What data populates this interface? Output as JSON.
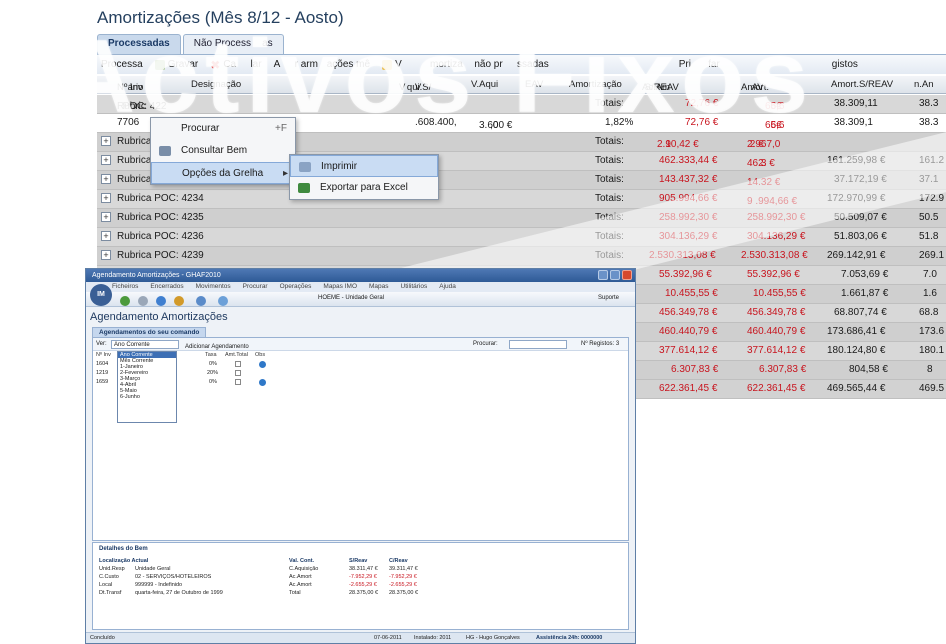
{
  "back": {
    "title": "Amortizações (Mês 8/12 - A",
    "title_tail": "osto)",
    "tabs": [
      {
        "label": "Processadas"
      },
      {
        "label": "Não Process",
        "tail": "as"
      }
    ],
    "toolbar": {
      "process": "Processa",
      "save": "Gravar",
      "cancel": "Ca",
      "cancel_tail": "lar",
      "warn_a": "A",
      "warn_a_tail": "r arm",
      "warn_a_end": "ações mê",
      "v_label": "V",
      "amort_label": "mortiza",
      "not_processed": "não pr",
      "not_processed_end": "ssadas",
      "pr": "Pri",
      "pr_tail": "far",
      "regist": "gistos"
    },
    "columns": {
      "inv": "Nº Inv",
      "inv_tail": "ário",
      "desig": "Designação",
      "vaqui": "V",
      "vaqui_tail": "qui.S/",
      "vaqui_end": "V",
      "vaqui2": "V.Aqui",
      "reav": "EAV",
      "amort": "Amortização",
      "acam": "Ac.Am",
      "acam_tail": "S/REAV",
      "amort2": "Amort.",
      "amort2_tail": "AV",
      "amort_s": "Amort.S/REAV",
      "an": "n.An"
    },
    "rows": [
      {
        "label": "Rubric",
        "label_tail": "POC: 422",
        "totals": "Totais:",
        "acam": "72,76 €",
        "amort2": "65,6",
        "amort2_tail": "6€",
        "amort_s": "38.309,11",
        "last": "38.3"
      },
      {
        "label": "7706",
        "v1": ".608.400,",
        "v2": "3.60",
        "v2_tail": ",00 €",
        "pct": "1,82%",
        "acam": "72,76 €",
        "amort2": "65,6",
        "amort2_tail": "6€",
        "amort_s": "38.309,1",
        "last": "38.3"
      },
      {
        "label": "Rubrica",
        "totals": "Totais:",
        "acam": "2.9",
        "acam_tail": "10,42 €",
        "amort2": "2.967,0",
        "amort2_tail": "2 €",
        "amort_s": "",
        "last": ""
      },
      {
        "label": "Rubrica",
        "totals": "Totais:",
        "acam": "462.333,44 €",
        "amort2": "462.",
        "amort2_tail": "3 €",
        "amort_s": "161.259,98 €",
        "last": "161.2"
      },
      {
        "label": "Rubrica",
        "totals": "Totais:",
        "acam": "143.437,32 €",
        "amort2": "14",
        "amort2_tail": ".32 €",
        "amort_s": "37.172,19 €",
        "last": "37.1"
      },
      {
        "label": "Rubrica POC: 4234",
        "totals": "Totais:",
        "acam": "905.994,66 €",
        "amort2": "9",
        "amort2_tail": ".994,66 €",
        "amort_s": "172.970,99 €",
        "last": "172.9"
      },
      {
        "label": "Rubrica POC: 4235",
        "totals": "Totais:",
        "acam": "258.992,30 €",
        "amort2": "258.992,30 €",
        "amort_s": "50.509,07 €",
        "last": "50.5"
      },
      {
        "label": "Rubrica POC: 4236",
        "totals": "Totais:",
        "acam": "304.136,29 €",
        "amort2": "304.136,29 €",
        "amort_s": "51.803,06 €",
        "last": "51.8"
      },
      {
        "label": "Rubrica POC: 4239",
        "totals": "Totais:",
        "acam": "2.530.313,08 €",
        "amort2": "2.530.313,08 €",
        "amort_s": "269.142,91 €",
        "last": "269.1"
      },
      {
        "label": "",
        "acam": "55.392,96 €",
        "amort2": "55.392,96 €",
        "amort_s": "7.053,69 €",
        "last": "7.0"
      },
      {
        "label": "",
        "acam": "10.455,55 €",
        "amort2": "10.455,55 €",
        "amort_s": "1.661,87 €",
        "last": "1.6"
      },
      {
        "label": "",
        "acam": "456.349,78 €",
        "amort2": "456.349,78 €",
        "amort_s": "68.807,74 €",
        "last": "68.8"
      },
      {
        "label": "",
        "acam": "460.440,79 €",
        "amort2": "460.440,79 €",
        "amort_s": "173.686,41 €",
        "last": "173.6"
      },
      {
        "label": "",
        "acam": "377.614,12 €",
        "amort2": "377.614,12 €",
        "amort_s": "180.124,80 €",
        "last": "180.1"
      },
      {
        "label": "",
        "acam": "6.307,83 €",
        "amort2": "6.307,83 €",
        "amort_s": "804,58 €",
        "last": "8"
      },
      {
        "label": "",
        "acam": "622.361,45 €",
        "amort2": "622.361,45 €",
        "amort_s": "469.565,44 €",
        "last": "469.5"
      }
    ]
  },
  "watermark": "Activos Fixos",
  "context_menu": {
    "items": [
      {
        "label": "Procurar",
        "key": "+F"
      },
      {
        "label": "Consultar Bem"
      },
      {
        "label": "Opções da Grelha"
      }
    ]
  },
  "submenu": {
    "items": [
      {
        "label": "Imprimir"
      },
      {
        "label": "Exportar para Excel"
      }
    ]
  },
  "front": {
    "window_title": "Agendamento Amortizações - GHAF2010",
    "menu": [
      "Ficheiros",
      "Encerrados",
      "Movimentos",
      "Procurar",
      "Operações",
      "Mapas IMO",
      "Mapas",
      "Utilitários",
      "Ajuda"
    ],
    "logo": "IM",
    "toolbar_entity": "HOEME - Unidade Geral",
    "toolbar_support": "Suporte",
    "heading": "Agendamento Amortizações",
    "tab": "Agendamentos do seu comando",
    "filter": {
      "ver_label": "Ver:",
      "ver_value": "Ano Corrente",
      "add_label": "Adicionar Agendamento",
      "search_label": "Procurar:",
      "records_label": "Nº Registos: 3"
    },
    "dropdown_options": [
      "Ano Corrente",
      "Mês Corrente",
      "1-Janeiro",
      "2-Fevereiro",
      "3-Março",
      "4-Abril",
      "5-Maio",
      "6-Junho"
    ],
    "grid_cols": [
      "Nº Inv",
      "Taxa",
      "Amt.Total",
      "Obs"
    ],
    "grid_rows": [
      {
        "inv": "1604",
        "rate": "0%"
      },
      {
        "inv": "1219",
        "rate": "20%"
      },
      {
        "inv": "1659",
        "rate": "0%"
      }
    ],
    "details": {
      "title": "Detalhes do Bem",
      "loc_header": "Localização Actual",
      "loc": [
        {
          "k": "Unid.Resp",
          "v": "Unidade Geral"
        },
        {
          "k": "C.Custo",
          "v": "02 - SERVIÇOS/HOTELEIROS"
        },
        {
          "k": "Local",
          "v": "999999 - Indefinido"
        },
        {
          "k": "Dt.Transf",
          "v": "quarta-feira, 27 de Outubro de 1999"
        }
      ],
      "val_header": "Val. Cont.",
      "val_cols": [
        "S/Reav",
        "C/Reav"
      ],
      "val_rows": [
        {
          "k": "C.Aquisição",
          "a": "38.311,47 €",
          "b": "39.311,47 €"
        },
        {
          "k": "Ac.Amort",
          "a": "-7.952,29 €",
          "b": "-7.952,29 €"
        },
        {
          "k": "Ac.Amort",
          "a": "-2.655,29 €",
          "b": "-2.655,29 €"
        },
        {
          "k": "Total",
          "a": "28.375,00 €",
          "b": "28.375,00 €"
        }
      ]
    },
    "status_left": "Concluído",
    "status_date": "07-06-2011",
    "status_exercise": "Instalado: 2011",
    "status_user": "HG - Hugo Gonçalves",
    "status_assist": "Assistência 24h: 0000000"
  },
  "colors": {
    "accent": "#25405f",
    "danger_values": "#c8141e",
    "grid_row": "#d8d8d8",
    "menu_highlight": "#c9dcf3"
  }
}
